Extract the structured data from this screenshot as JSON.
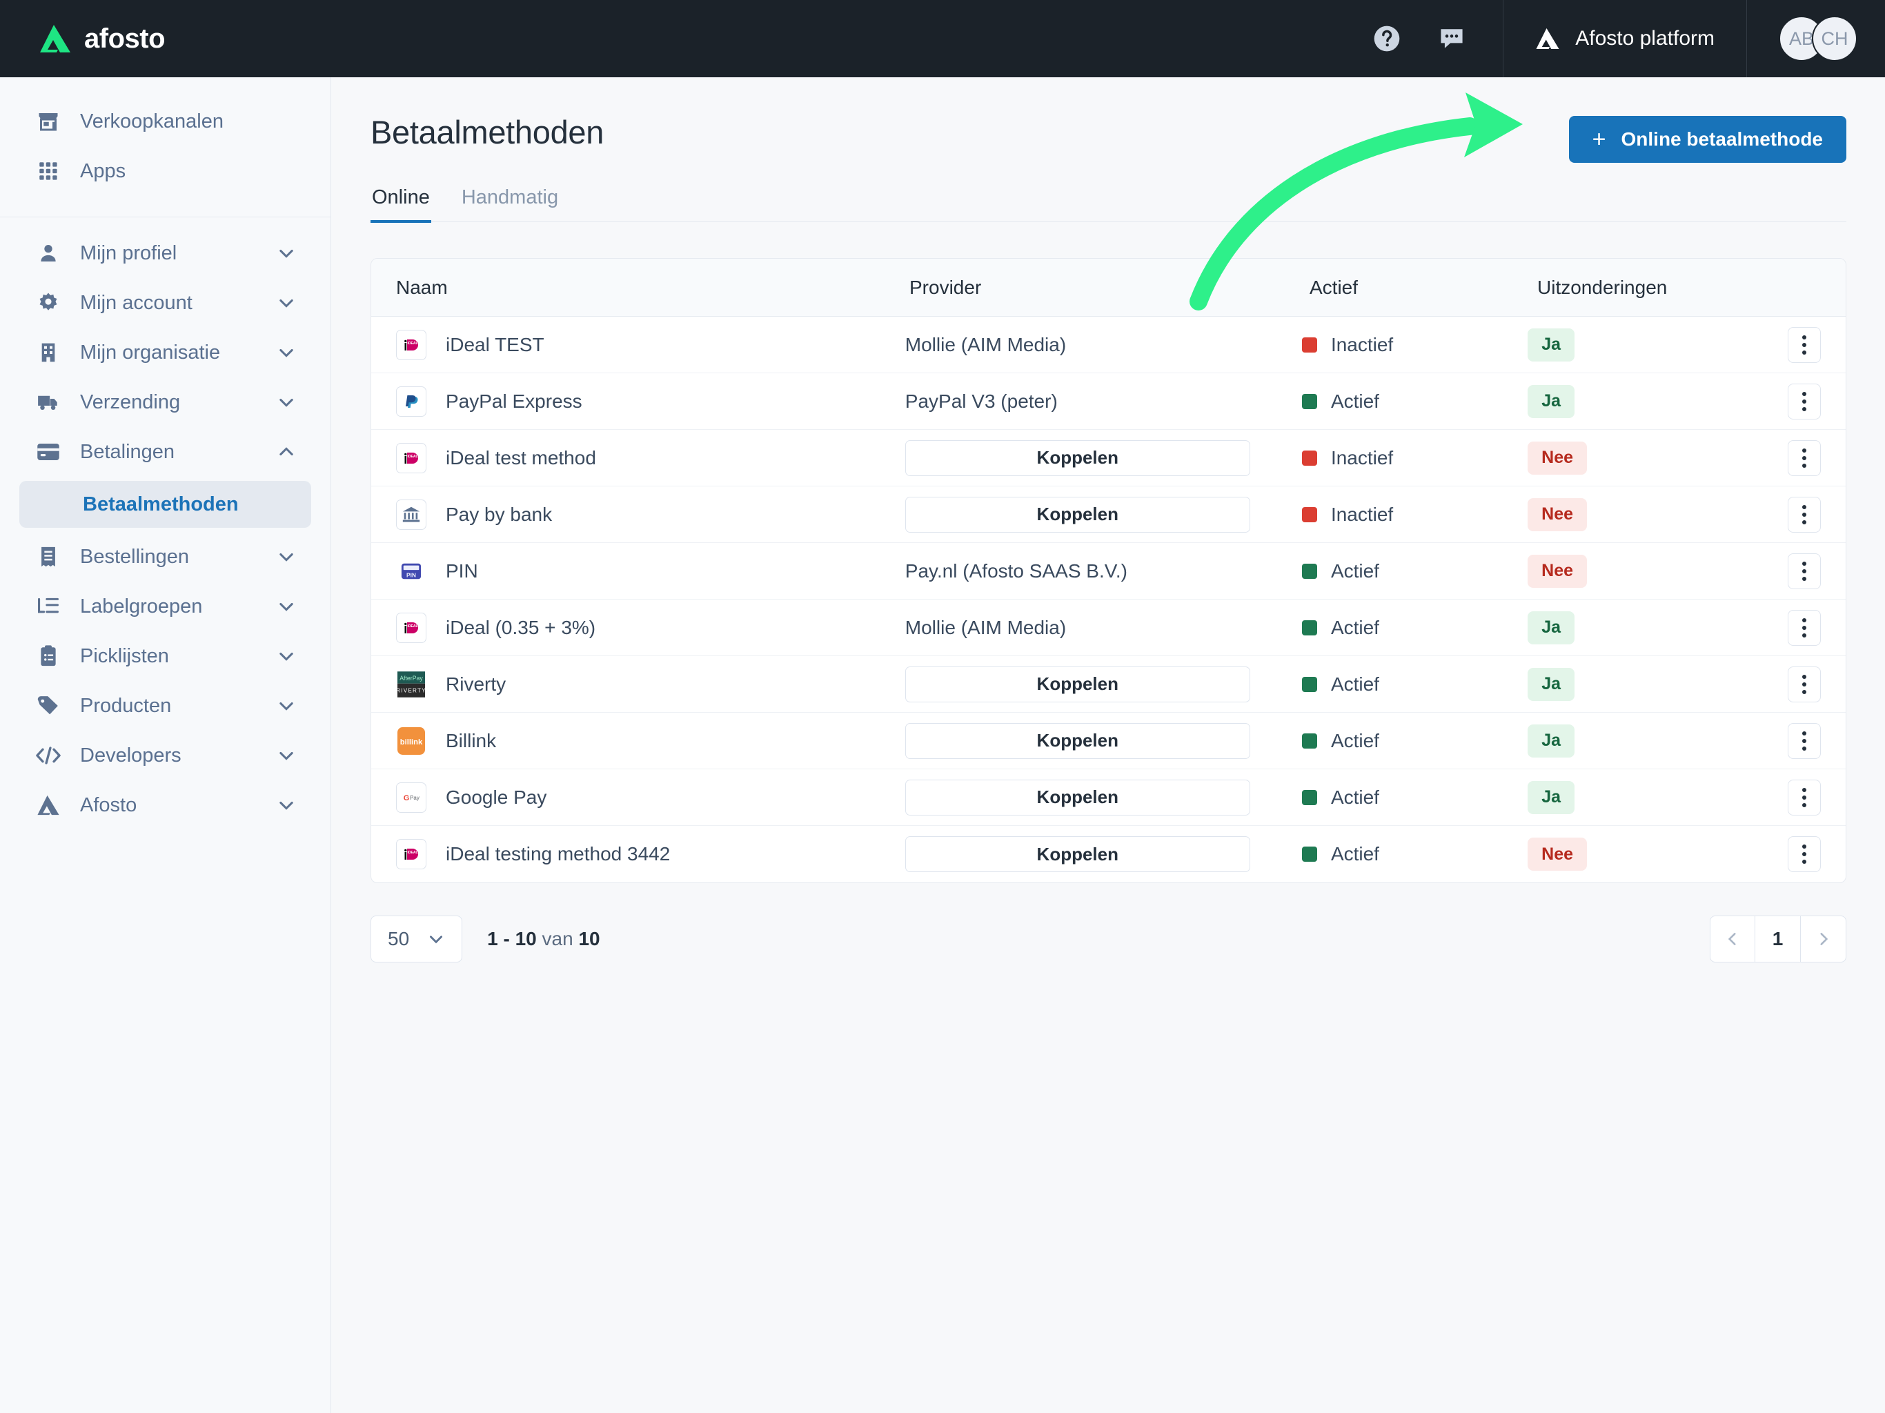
{
  "topbar": {
    "brand_name": "afosto",
    "logo_icon": "afosto-triangle-logo",
    "help_icon": "question-circle-icon",
    "chat_icon": "chat-bubble-icon",
    "platform_icon": "afosto-triangle-icon",
    "platform_label": "Afosto platform",
    "avatars": [
      {
        "initials": "AB",
        "name": "avatar-ab"
      },
      {
        "initials": "CH",
        "name": "avatar-ch"
      }
    ]
  },
  "sidebar": {
    "top_items": [
      {
        "label": "Verkoopkanalen",
        "icon": "storefront-icon",
        "chevron": false
      },
      {
        "label": "Apps",
        "icon": "grid-apps-icon",
        "chevron": false
      }
    ],
    "items": [
      {
        "label": "Mijn profiel",
        "icon": "person-icon",
        "chevron": "down"
      },
      {
        "label": "Mijn account",
        "icon": "gear-icon",
        "chevron": "down"
      },
      {
        "label": "Mijn organisatie",
        "icon": "building-icon",
        "chevron": "down"
      },
      {
        "label": "Verzending",
        "icon": "truck-icon",
        "chevron": "down"
      },
      {
        "label": "Betalingen",
        "icon": "credit-card-icon",
        "chevron": "up",
        "expanded": true
      },
      {
        "label": "Bestellingen",
        "icon": "receipt-icon",
        "chevron": "down"
      },
      {
        "label": "Labelgroepen",
        "icon": "list-tree-icon",
        "chevron": "down"
      },
      {
        "label": "Picklijsten",
        "icon": "clipboard-icon",
        "chevron": "down"
      },
      {
        "label": "Producten",
        "icon": "tag-icon",
        "chevron": "down"
      },
      {
        "label": "Developers",
        "icon": "code-brackets-icon",
        "chevron": "down"
      },
      {
        "label": "Afosto",
        "icon": "afosto-triangle-icon",
        "chevron": "down"
      }
    ],
    "sub_item_active": "Betaalmethoden"
  },
  "page": {
    "title": "Betaalmethoden",
    "primary_button": {
      "label": "Online betaalmethode",
      "icon": "plus-icon"
    },
    "tabs": [
      {
        "label": "Online",
        "active": true
      },
      {
        "label": "Handmatig",
        "active": false
      }
    ]
  },
  "table": {
    "columns": [
      "Naam",
      "Provider",
      "Actief",
      "Uitzonderingen"
    ],
    "link_button_label": "Koppelen",
    "menu_icon": "kebab-menu-icon",
    "rows": [
      {
        "icon": "ideal-logo",
        "name": "iDeal TEST",
        "provider": "Mollie (AIM Media)",
        "has_link_button": false,
        "active_label": "Inactief",
        "active": false,
        "exception": "Ja"
      },
      {
        "icon": "paypal-logo",
        "name": "PayPal Express",
        "provider": "PayPal V3 (peter)",
        "has_link_button": false,
        "active_label": "Actief",
        "active": true,
        "exception": "Ja"
      },
      {
        "icon": "ideal-logo",
        "name": "iDeal test method",
        "provider": "",
        "has_link_button": true,
        "active_label": "Inactief",
        "active": false,
        "exception": "Nee"
      },
      {
        "icon": "bank-logo",
        "name": "Pay by bank",
        "provider": "",
        "has_link_button": true,
        "active_label": "Inactief",
        "active": false,
        "exception": "Nee"
      },
      {
        "icon": "pin-logo",
        "name": "PIN",
        "provider": "Pay.nl (Afosto SAAS B.V.)",
        "has_link_button": false,
        "active_label": "Actief",
        "active": true,
        "exception": "Nee"
      },
      {
        "icon": "ideal-logo",
        "name": "iDeal (0.35 + 3%)",
        "provider": "Mollie (AIM Media)",
        "has_link_button": false,
        "active_label": "Actief",
        "active": true,
        "exception": "Ja"
      },
      {
        "icon": "riverty-logo",
        "name": "Riverty",
        "provider": "",
        "has_link_button": true,
        "active_label": "Actief",
        "active": true,
        "exception": "Ja"
      },
      {
        "icon": "billink-logo",
        "name": "Billink",
        "provider": "",
        "has_link_button": true,
        "active_label": "Actief",
        "active": true,
        "exception": "Ja"
      },
      {
        "icon": "googlepay-logo",
        "name": "Google Pay",
        "provider": "",
        "has_link_button": true,
        "active_label": "Actief",
        "active": true,
        "exception": "Ja"
      },
      {
        "icon": "ideal-logo",
        "name": "iDeal testing method 3442",
        "provider": "",
        "has_link_button": true,
        "active_label": "Actief",
        "active": true,
        "exception": "Nee"
      }
    ]
  },
  "footer": {
    "page_size": "50",
    "page_size_chevron": "chevron-down-icon",
    "range_start": "1 - 10",
    "range_word": " van ",
    "range_total": "10",
    "prev_icon": "chevron-left-icon",
    "next_icon": "chevron-right-icon",
    "current_page": "1"
  },
  "annotation": {
    "arrow_color": "#2ef08a",
    "name": "green-curved-arrow"
  },
  "colors": {
    "accent_blue": "#1873b9",
    "topbar_bg": "#1b2229",
    "active_green": "#1e7a52",
    "inactive_red": "#db3e32"
  }
}
